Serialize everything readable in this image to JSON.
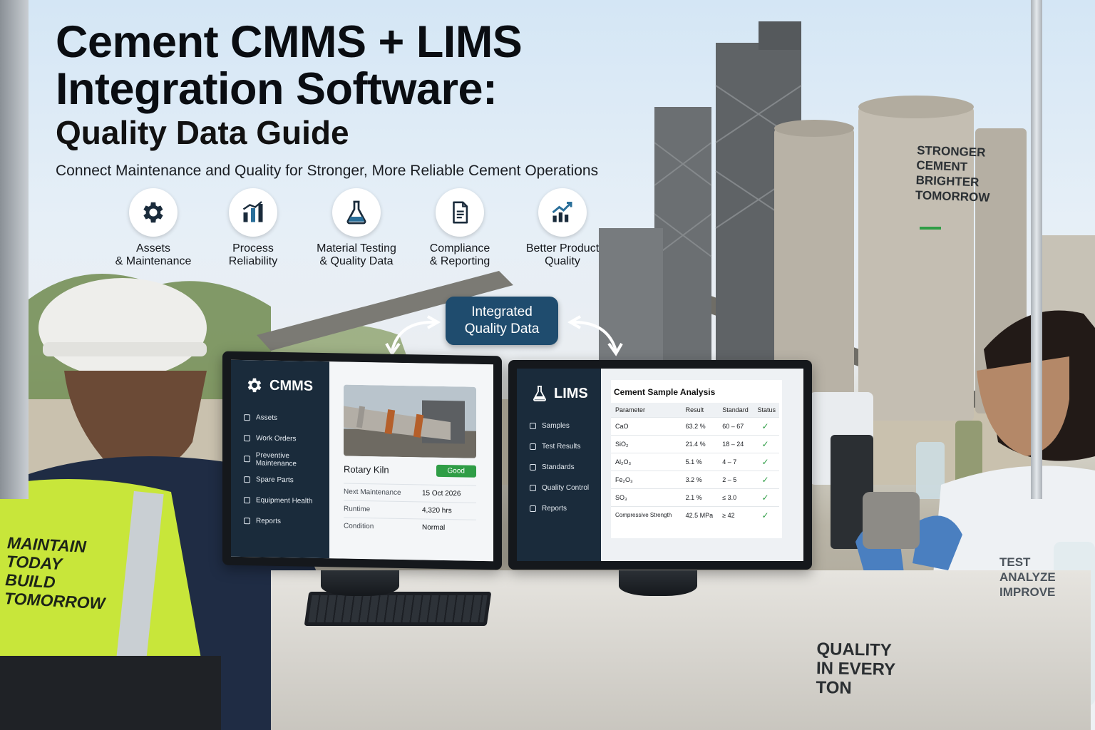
{
  "headline": {
    "title_line_1": "Cement CMMS + LIMS",
    "title_line_2": "Integration Software:",
    "title_line_3": "Quality Data Guide",
    "subtitle": "Connect Maintenance and Quality for Stronger, More Reliable Cement Operations"
  },
  "features": [
    {
      "icon": "gear-icon",
      "line1": "Assets",
      "line2": "& Maintenance"
    },
    {
      "icon": "bar-chart-icon",
      "line1": "Process",
      "line2": "Reliability"
    },
    {
      "icon": "flask-icon",
      "line1": "Material Testing",
      "line2": "& Quality Data"
    },
    {
      "icon": "document-icon",
      "line1": "Compliance",
      "line2": "& Reporting"
    },
    {
      "icon": "trend-up-icon",
      "line1": "Better Product",
      "line2": "Quality"
    }
  ],
  "badge": {
    "line1": "Integrated",
    "line2": "Quality Data"
  },
  "cmms": {
    "app_title": "CMMS",
    "nav": [
      "Assets",
      "Work Orders",
      "Preventive Maintenance",
      "Spare Parts",
      "Equipment Health",
      "Reports"
    ],
    "asset_name": "Rotary Kiln",
    "status": "Good",
    "info": [
      {
        "label": "Next Maintenance",
        "value": "15 Oct 2026"
      },
      {
        "label": "Runtime",
        "value": "4,320 hrs"
      },
      {
        "label": "Condition",
        "value": "Normal"
      }
    ]
  },
  "lims": {
    "app_title": "LIMS",
    "nav": [
      "Samples",
      "Test Results",
      "Standards",
      "Quality Control",
      "Reports"
    ],
    "table_title": "Cement Sample Analysis",
    "columns": [
      "Parameter",
      "Result",
      "Standard",
      "Status"
    ],
    "rows": [
      {
        "parameter": "CaO",
        "result": "63.2 %",
        "standard": "60 – 67",
        "status": "✓"
      },
      {
        "parameter": "SiO₂",
        "result": "21.4 %",
        "standard": "18 – 24",
        "status": "✓"
      },
      {
        "parameter": "Al₂O₃",
        "result": "5.1 %",
        "standard": "4 – 7",
        "status": "✓"
      },
      {
        "parameter": "Fe₂O₃",
        "result": "3.2 %",
        "standard": "2 – 5",
        "status": "✓"
      },
      {
        "parameter": "SO₃",
        "result": "2.1 %",
        "standard": "≤ 3.0",
        "status": "✓"
      },
      {
        "parameter": "Compressive Strength",
        "result": "42.5 MPa",
        "standard": "≥ 42",
        "status": "✓"
      }
    ]
  },
  "scene_text": {
    "vest": [
      "MAINTAIN",
      "TODAY",
      "BUILD",
      "TOMORROW"
    ],
    "silo": [
      "STRONGER",
      "CEMENT",
      "BRIGHTER",
      "TOMORROW"
    ],
    "coat": [
      "TEST",
      "ANALYZE",
      "IMPROVE"
    ],
    "bag": [
      "QUALITY",
      "IN EVERY",
      "TON"
    ]
  },
  "colors": {
    "sidebar": "#1a2b3b",
    "badge": "#1f4c6e",
    "status_good": "#2f9d46",
    "vest": "#c8e63a"
  }
}
